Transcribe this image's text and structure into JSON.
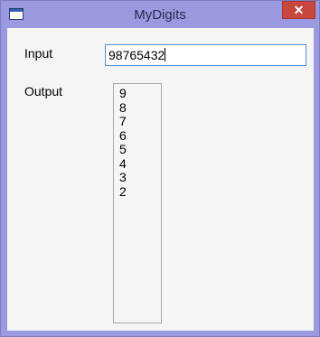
{
  "window": {
    "title": "MyDigits",
    "close_label": "✕"
  },
  "form": {
    "input_label": "Input",
    "input_value": "98765432",
    "output_label": "Output",
    "output_items": [
      "9",
      "8",
      "7",
      "6",
      "5",
      "4",
      "3",
      "2"
    ]
  },
  "colors": {
    "frame": "#9b99e0",
    "close_button": "#c9473c",
    "client_background": "#f5f5f5",
    "input_focus_border": "#5a8fd6"
  },
  "icons": {
    "app": "window-icon",
    "close": "close-icon"
  }
}
